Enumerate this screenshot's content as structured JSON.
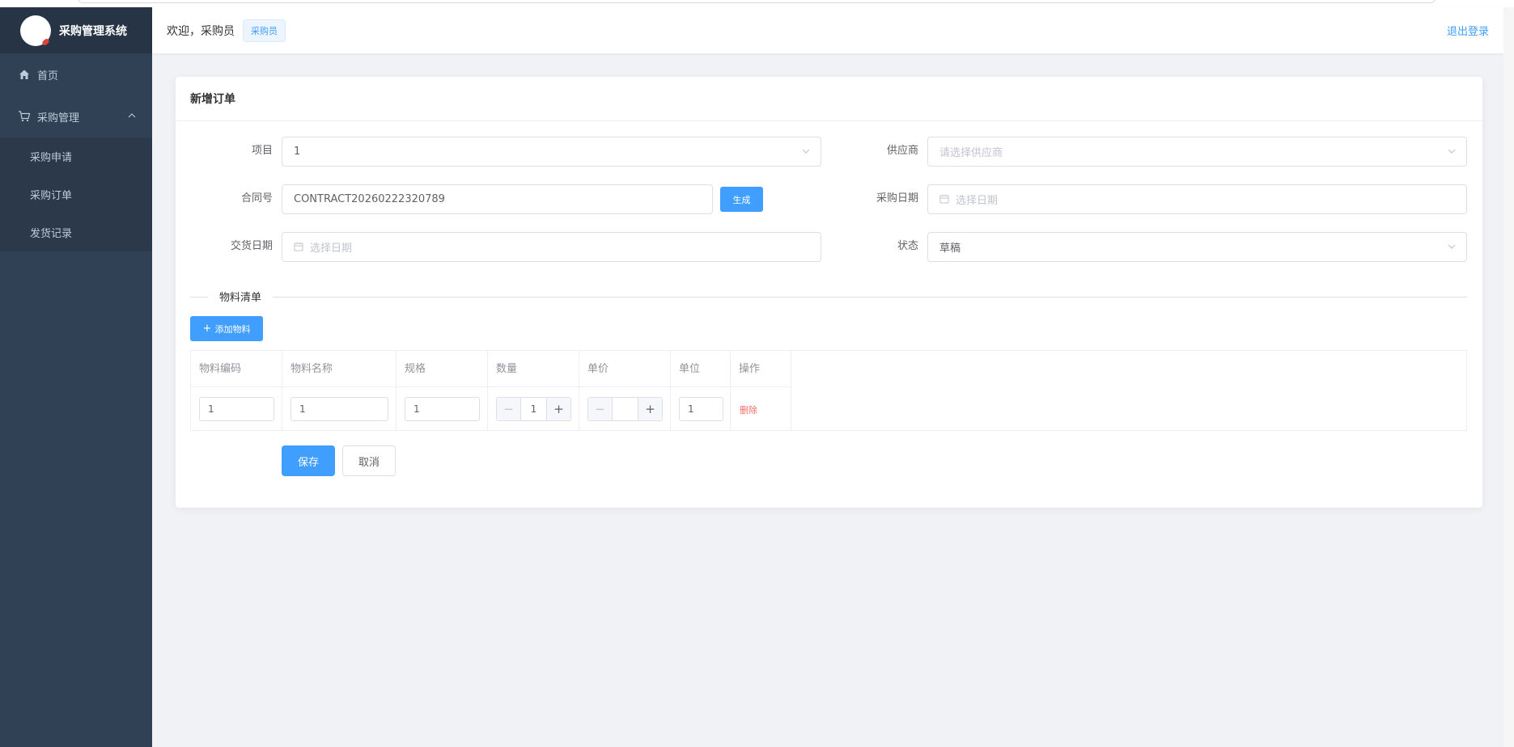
{
  "app": {
    "title": "采购管理系统"
  },
  "header": {
    "welcome": "欢迎，采购员",
    "role_tag": "采购员",
    "logout": "退出登录"
  },
  "sidebar": {
    "items": [
      {
        "label": "首页",
        "icon": "home-icon"
      },
      {
        "label": "采购管理",
        "icon": "cart-icon"
      }
    ],
    "sub_items": [
      {
        "label": "采购申请"
      },
      {
        "label": "采购订单"
      },
      {
        "label": "发货记录"
      }
    ]
  },
  "card": {
    "title": "新增订单"
  },
  "form": {
    "project": {
      "label": "项目",
      "value": "1"
    },
    "supplier": {
      "label": "供应商",
      "placeholder": "请选择供应商"
    },
    "contract": {
      "label": "合同号",
      "value": "CONTRACT20260222320789",
      "generate": "生成"
    },
    "purchase_date": {
      "label": "采购日期",
      "placeholder": "选择日期"
    },
    "delivery_date": {
      "label": "交货日期",
      "placeholder": "选择日期"
    },
    "status": {
      "label": "状态",
      "value": "草稿"
    }
  },
  "materials": {
    "section_title": "物料清单",
    "add_button": "添加物料",
    "columns": [
      "物料编码",
      "物料名称",
      "规格",
      "数量",
      "单价",
      "单位",
      "操作"
    ],
    "rows": [
      {
        "code": "1",
        "name": "1",
        "spec": "1",
        "qty": "1",
        "price": "",
        "unit": "1",
        "action": "删除"
      }
    ]
  },
  "actions": {
    "save": "保存",
    "cancel": "取消"
  },
  "colors": {
    "primary": "#409eff",
    "sidebar_bg": "#304156",
    "danger": "#f56c6c"
  }
}
